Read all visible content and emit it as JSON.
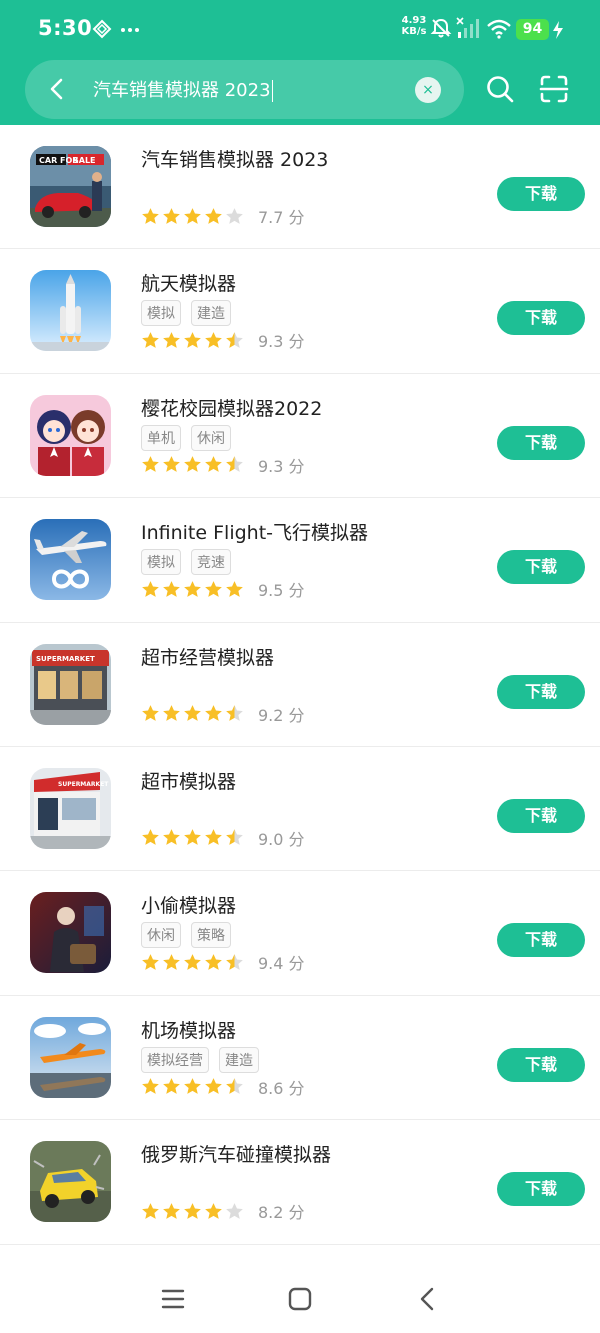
{
  "status_bar": {
    "time": "5:30",
    "net_speed_value": "4.93",
    "net_speed_unit": "KB/s",
    "battery": "94",
    "icons": [
      "diamond-icon",
      "more-dots-icon",
      "mute-bell-icon",
      "signal-icon",
      "wifi-icon",
      "charging-icon"
    ]
  },
  "search": {
    "query": "汽车销售模拟器 2023",
    "clear_label": "×"
  },
  "colors": {
    "accent": "#1ebf95",
    "star": "#f8bf26",
    "star_empty": "#dcdcdc"
  },
  "apps": [
    {
      "name": "汽车销售模拟器 2023",
      "tags": [],
      "rating": 4,
      "score": "7.7 分",
      "button": "下载",
      "icon": "car-for-sale-icon"
    },
    {
      "name": "航天模拟器",
      "tags": [
        "模拟",
        "建造"
      ],
      "rating": 4.5,
      "score": "9.3 分",
      "button": "下载",
      "icon": "rocket-icon"
    },
    {
      "name": "樱花校园模拟器2022",
      "tags": [
        "单机",
        "休闲"
      ],
      "rating": 4.5,
      "score": "9.3 分",
      "button": "下载",
      "icon": "anime-girls-icon"
    },
    {
      "name": "Infinite Flight-飞行模拟器",
      "tags": [
        "模拟",
        "竞速"
      ],
      "rating": 5,
      "score": "9.5 分",
      "button": "下载",
      "icon": "airplane-icon"
    },
    {
      "name": "超市经营模拟器",
      "tags": [],
      "rating": 4.5,
      "score": "9.2 分",
      "button": "下载",
      "icon": "supermarket-icon"
    },
    {
      "name": "超市模拟器",
      "tags": [],
      "rating": 4.5,
      "score": "9.0 分",
      "button": "下载",
      "icon": "supermarket-store-icon"
    },
    {
      "name": "小偷模拟器",
      "tags": [
        "休闲",
        "策略"
      ],
      "rating": 4.5,
      "score": "9.4 分",
      "button": "下载",
      "icon": "thief-icon"
    },
    {
      "name": "机场模拟器",
      "tags": [
        "模拟经营",
        "建造"
      ],
      "rating": 4.5,
      "score": "8.6 分",
      "button": "下载",
      "icon": "airport-icon"
    },
    {
      "name": "俄罗斯汽车碰撞模拟器",
      "tags": [],
      "rating": 4,
      "score": "8.2 分",
      "button": "下载",
      "icon": "crash-car-icon"
    }
  ],
  "nav": {
    "icons": [
      "menu-icon",
      "home-icon",
      "back-icon"
    ]
  }
}
